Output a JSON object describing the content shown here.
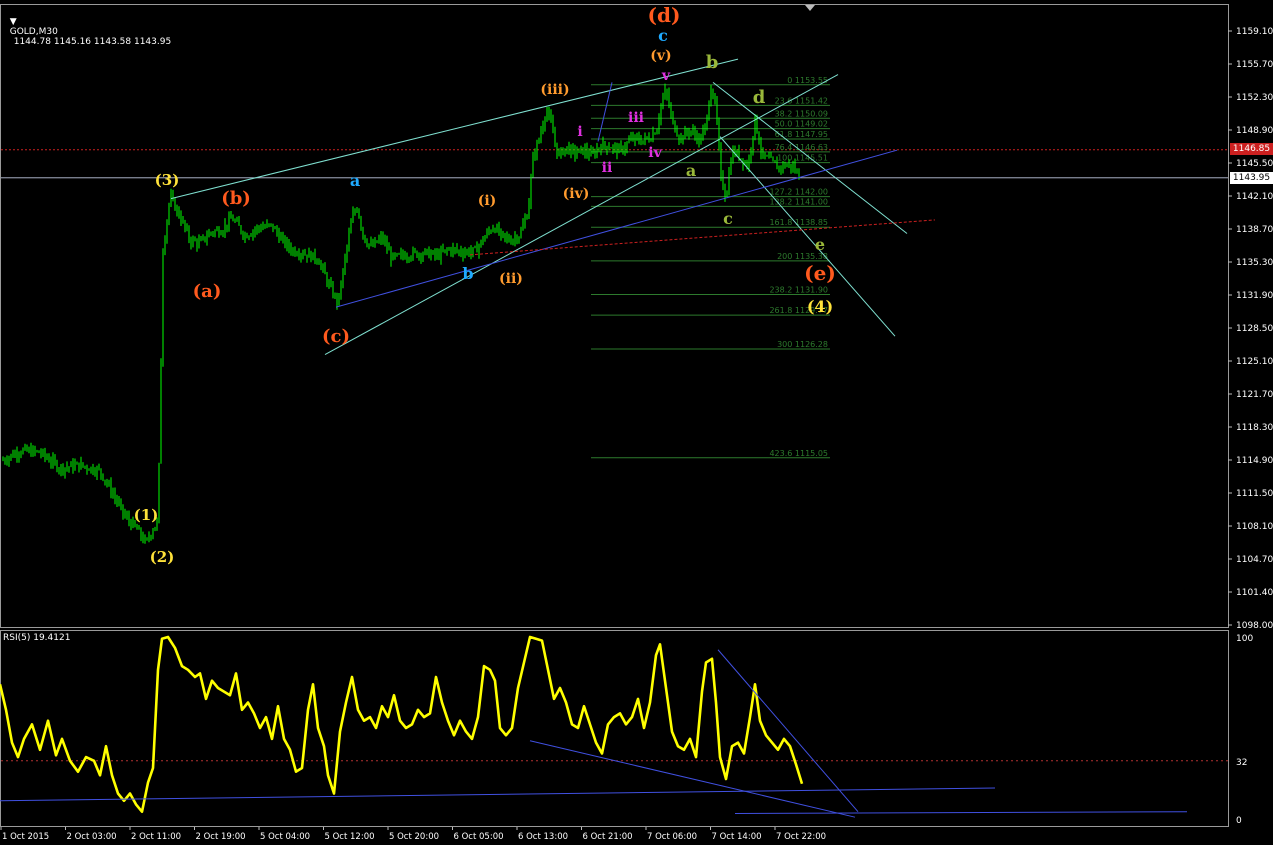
{
  "header": {
    "symbol": "GOLD,M30",
    "ohlc": "1144.78 1145.16 1143.58 1143.95"
  },
  "rsi_header": "RSI(5) 19.4121",
  "price_axis_labels": [
    "1159.10",
    "1155.70",
    "1152.30",
    "1148.90",
    "1145.50",
    "1142.10",
    "1138.70",
    "1135.30",
    "1131.90",
    "1128.50",
    "1125.10",
    "1121.70",
    "1118.30",
    "1114.90",
    "1111.50",
    "1108.10",
    "1104.70",
    "1101.40",
    "1098.00"
  ],
  "rsi_axis_labels": [
    "100",
    "32",
    "0"
  ],
  "time_axis_labels": [
    "1 Oct 2015",
    "2 Oct 03:00",
    "2 Oct 11:00",
    "2 Oct 19:00",
    "5 Oct 04:00",
    "5 Oct 12:00",
    "5 Oct 20:00",
    "6 Oct 05:00",
    "6 Oct 13:00",
    "6 Oct 21:00",
    "7 Oct 06:00",
    "7 Oct 14:00",
    "7 Oct 22:00"
  ],
  "boxes": {
    "red_line_price": "1146.85",
    "current_price": "1143.95"
  },
  "colors": {
    "background": "#000000",
    "candles": "#00ff00",
    "rsi": "#ffff00",
    "orange": "#ff5a1e",
    "amber": "#ff9b2e",
    "yellow": "#ffe23a",
    "cyan": "#1eaaff",
    "magenta": "#e030e0",
    "olive": "#9ab83a",
    "trend_cyan": "#7fe0d0",
    "trend_blue": "#4050e0",
    "fib": "#2d7a2d",
    "red_dotted": "#cc2020"
  },
  "fib_levels": [
    {
      "label": "0 1153.55"
    },
    {
      "label": "23.6 1151.42"
    },
    {
      "label": "38.2 1150.09"
    },
    {
      "label": "50.0 1149.02"
    },
    {
      "label": "61.8 1147.95"
    },
    {
      "label": "76.4 1146.63"
    },
    {
      "label": "100 1145.51"
    },
    {
      "label": "127.2 1142.00"
    },
    {
      "label": "138.2 1141.00"
    },
    {
      "label": "161.8 1138.85"
    },
    {
      "label": "200 1135.38"
    },
    {
      "label": "238.2 1131.90"
    },
    {
      "label": "261.8 1129.77"
    },
    {
      "label": "300 1126.28"
    },
    {
      "label": "423.6 1115.05"
    }
  ],
  "wave_labels": [
    {
      "text": "(1)",
      "color": "yellow"
    },
    {
      "text": "(2)",
      "color": "yellow"
    },
    {
      "text": "(3)",
      "color": "yellow"
    },
    {
      "text": "(4)",
      "color": "yellow"
    },
    {
      "text": "(a)",
      "color": "orange"
    },
    {
      "text": "(b)",
      "color": "orange"
    },
    {
      "text": "(c)",
      "color": "orange"
    },
    {
      "text": "(d)",
      "color": "orange"
    },
    {
      "text": "(e)",
      "color": "orange"
    },
    {
      "text": "a",
      "color": "cyan"
    },
    {
      "text": "b",
      "color": "cyan"
    },
    {
      "text": "c",
      "color": "cyan"
    },
    {
      "text": "(i)",
      "color": "amber"
    },
    {
      "text": "(ii)",
      "color": "amber"
    },
    {
      "text": "(iii)",
      "color": "amber"
    },
    {
      "text": "(iv)",
      "color": "amber"
    },
    {
      "text": "(v)",
      "color": "amber"
    },
    {
      "text": "i",
      "color": "magenta"
    },
    {
      "text": "ii",
      "color": "magenta"
    },
    {
      "text": "iii",
      "color": "magenta"
    },
    {
      "text": "iv",
      "color": "magenta"
    },
    {
      "text": "v",
      "color": "magenta"
    },
    {
      "text": "a",
      "color": "olive"
    },
    {
      "text": "b",
      "color": "olive"
    },
    {
      "text": "c",
      "color": "olive"
    },
    {
      "text": "d",
      "color": "olive"
    },
    {
      "text": "e",
      "color": "olive"
    }
  ],
  "chart_data": {
    "type": "candlestick",
    "symbol": "GOLD",
    "timeframe": "M30",
    "ylim": [
      1098.0,
      1161.0
    ],
    "series": [
      {
        "name": "GOLD,M30",
        "kind": "close",
        "x": [
          "1 Oct 2015",
          "2 Oct 03:00",
          "2 Oct 11:00",
          "2 Oct 19:00",
          "5 Oct 04:00",
          "5 Oct 12:00",
          "5 Oct 20:00",
          "6 Oct 05:00",
          "6 Oct 13:00",
          "6 Oct 21:00",
          "7 Oct 06:00",
          "7 Oct 14:00",
          "7 Oct 22:00"
        ],
        "values": [
          1116.0,
          1114.0,
          1138.0,
          1139.0,
          1137.0,
          1131.0,
          1135.5,
          1137.0,
          1149.0,
          1147.0,
          1151.0,
          1145.0,
          1143.95
        ]
      },
      {
        "name": "RSI(5)",
        "kind": "oscillator",
        "ylim": [
          0,
          100
        ],
        "level": 32,
        "last": 19.4121
      }
    ]
  }
}
